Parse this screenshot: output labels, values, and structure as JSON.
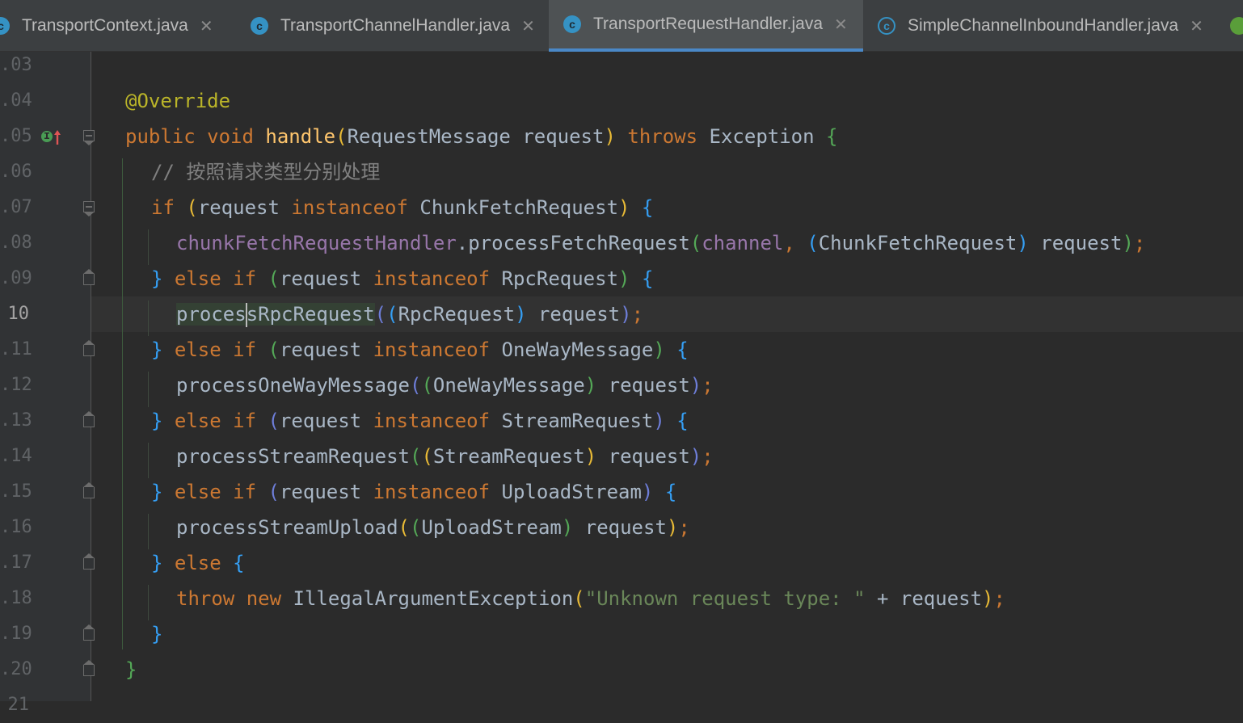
{
  "tabs": [
    {
      "label": "TransportContext.java",
      "active": false,
      "icon": "class-icon"
    },
    {
      "label": "TransportChannelHandler.java",
      "active": false,
      "icon": "class-icon"
    },
    {
      "label": "TransportRequestHandler.java",
      "active": true,
      "icon": "class-icon"
    },
    {
      "label": "SimpleChannelInboundHandler.java",
      "active": false,
      "icon": "abstract-class-icon"
    }
  ],
  "line_numbers": [
    ".03",
    ".04",
    ".05",
    ".06",
    ".07",
    ".08",
    ".09",
    "10",
    ".11",
    ".12",
    ".13",
    ".14",
    ".15",
    ".16",
    ".17",
    ".18",
    ".19",
    ".20",
    "21"
  ],
  "current_line": "10",
  "code": {
    "l104_annotation": "@Override",
    "l105": {
      "public": "public",
      "void": "void",
      "method": "handle",
      "param_type": "RequestMessage",
      "param": "request",
      "throws": "throws",
      "exception": "Exception"
    },
    "l106_comment": "// 按照请求类型分别处理",
    "l107": {
      "if": "if",
      "var": "request",
      "instanceof": "instanceof",
      "type": "ChunkFetchRequest"
    },
    "l108": {
      "field": "chunkFetchRequestHandler",
      "call": ".processFetchRequest",
      "arg1": "channel",
      "cast": "ChunkFetchRequest",
      "arg2": "request"
    },
    "l109": {
      "else": "else",
      "if": "if",
      "var": "request",
      "instanceof": "instanceof",
      "type": "RpcRequest"
    },
    "l110": {
      "call_a": "proces",
      "call_b": "sRpcRequest",
      "cast": "RpcRequest",
      "arg": "request"
    },
    "l111": {
      "else": "else",
      "if": "if",
      "var": "request",
      "instanceof": "instanceof",
      "type": "OneWayMessage"
    },
    "l112": {
      "call": "processOneWayMessage",
      "cast": "OneWayMessage",
      "arg": "request"
    },
    "l113": {
      "else": "else",
      "if": "if",
      "var": "request",
      "instanceof": "instanceof",
      "type": "StreamRequest"
    },
    "l114": {
      "call": "processStreamRequest",
      "cast": "StreamRequest",
      "arg": "request"
    },
    "l115": {
      "else": "else",
      "if": "if",
      "var": "request",
      "instanceof": "instanceof",
      "type": "UploadStream"
    },
    "l116": {
      "call": "processStreamUpload",
      "cast": "UploadStream",
      "arg": "request"
    },
    "l117_else": "else",
    "l118": {
      "throw": "throw",
      "new": "new",
      "type": "IllegalArgumentException",
      "str": "\"Unknown request type: \"",
      "arg": "request"
    }
  },
  "colors": {
    "background": "#2b2b2b",
    "keyword": "#cc7832",
    "method": "#ffc66d",
    "string": "#6a8759",
    "field": "#9876aa",
    "tab_underline": "#4a88c7"
  }
}
